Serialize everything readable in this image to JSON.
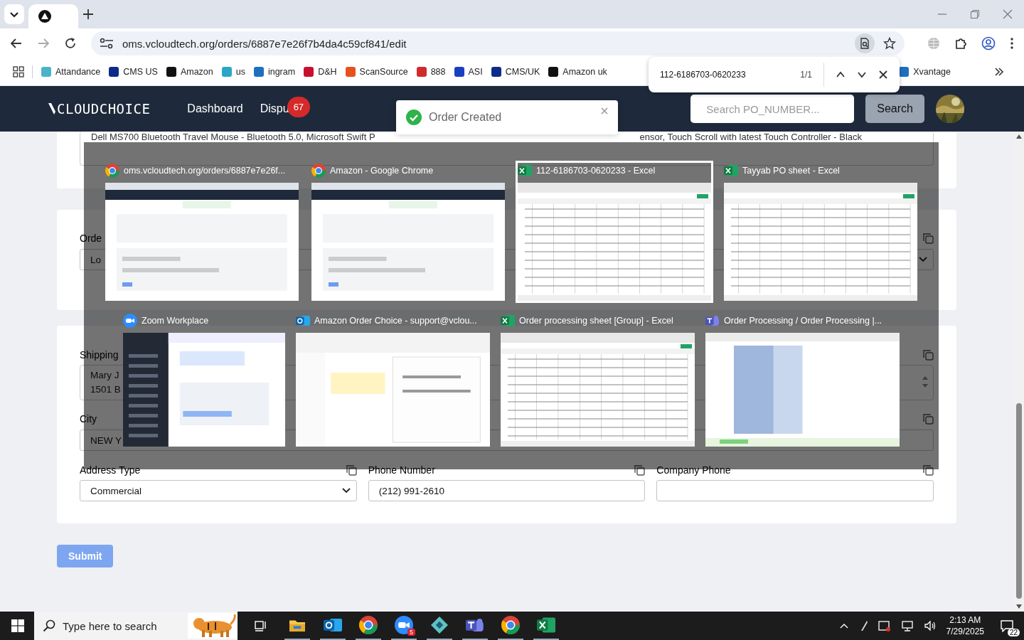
{
  "browser": {
    "address": "oms.vcloudtech.org/orders/6887e7e26f7b4da4c59cf841/edit",
    "bookmarks": [
      {
        "label": "Attandance"
      },
      {
        "label": "CMS US"
      },
      {
        "label": "Amazon"
      },
      {
        "label": "us"
      },
      {
        "label": "ingram"
      },
      {
        "label": "D&H"
      },
      {
        "label": "ScanSource"
      },
      {
        "label": "888"
      },
      {
        "label": "ASI"
      },
      {
        "label": "CMS/UK"
      },
      {
        "label": "Amazon uk"
      },
      {
        "label": "Xvantage"
      }
    ],
    "find_bar": {
      "query": "112-6186703-0620233",
      "count": "1/1"
    }
  },
  "app_header": {
    "logo": "CLOUDCHOICE",
    "nav": [
      {
        "label": "Dashboard"
      },
      {
        "label": "Dispu",
        "badge": "67"
      }
    ],
    "search": {
      "placeholder": "Search PO_NUMBER..."
    },
    "search_button": "Search"
  },
  "toast": {
    "message": "Order Created"
  },
  "form": {
    "description": {
      "left": "Dell MS700 Bluetooth Travel Mouse - Bluetooth 5.0, Microsoft Swift P",
      "right": "ensor, Touch Scroll with latest Touch Controller - Black"
    },
    "order_field": {
      "label": "Orde",
      "value": "Lo"
    },
    "shipping": {
      "label": "Shipping",
      "lines": [
        "Mary J",
        "1501 B"
      ]
    },
    "city": {
      "label": "City",
      "value": "NEW Y"
    },
    "bottom_fields": [
      {
        "label": "Address Type",
        "kind": "select",
        "value": "Commercial"
      },
      {
        "label": "Phone Number",
        "kind": "input",
        "value": "(212) 991-2610"
      },
      {
        "label": "Company Phone",
        "kind": "input"
      }
    ],
    "submit": "Submit"
  },
  "task_switcher": {
    "rows": [
      [
        {
          "title": "oms.vcloudtech.org/orders/6887e7e26f...",
          "kind": "chrome",
          "selected": false
        },
        {
          "title": "Amazon - Google Chrome",
          "kind": "chrome",
          "selected": false
        },
        {
          "title": "112-6186703-0620233 - Excel",
          "kind": "excel",
          "selected": true
        },
        {
          "title": "Tayyab PO sheet - Excel",
          "kind": "excel",
          "selected": false
        }
      ],
      [
        {
          "title": "Zoom Workplace",
          "kind": "zoom",
          "selected": false
        },
        {
          "title": "Amazon Order Choice - support@vclou...",
          "kind": "outlook",
          "selected": false
        },
        {
          "title": "Order processing sheet  [Group] - Excel",
          "kind": "excel",
          "selected": false
        },
        {
          "title": "Order Processing / Order Processing |...",
          "kind": "teams",
          "selected": false
        }
      ]
    ]
  },
  "taskbar": {
    "search_placeholder": "Type here to search",
    "apps": [
      {
        "kind": "explorer"
      },
      {
        "kind": "outlook"
      },
      {
        "kind": "chrome"
      },
      {
        "kind": "zoom",
        "badge": "5"
      },
      {
        "kind": "diamond"
      },
      {
        "kind": "teams"
      },
      {
        "kind": "chrome"
      },
      {
        "kind": "excel"
      }
    ],
    "time": "2:13 AM",
    "date": "7/29/2025",
    "notifications": "22"
  }
}
